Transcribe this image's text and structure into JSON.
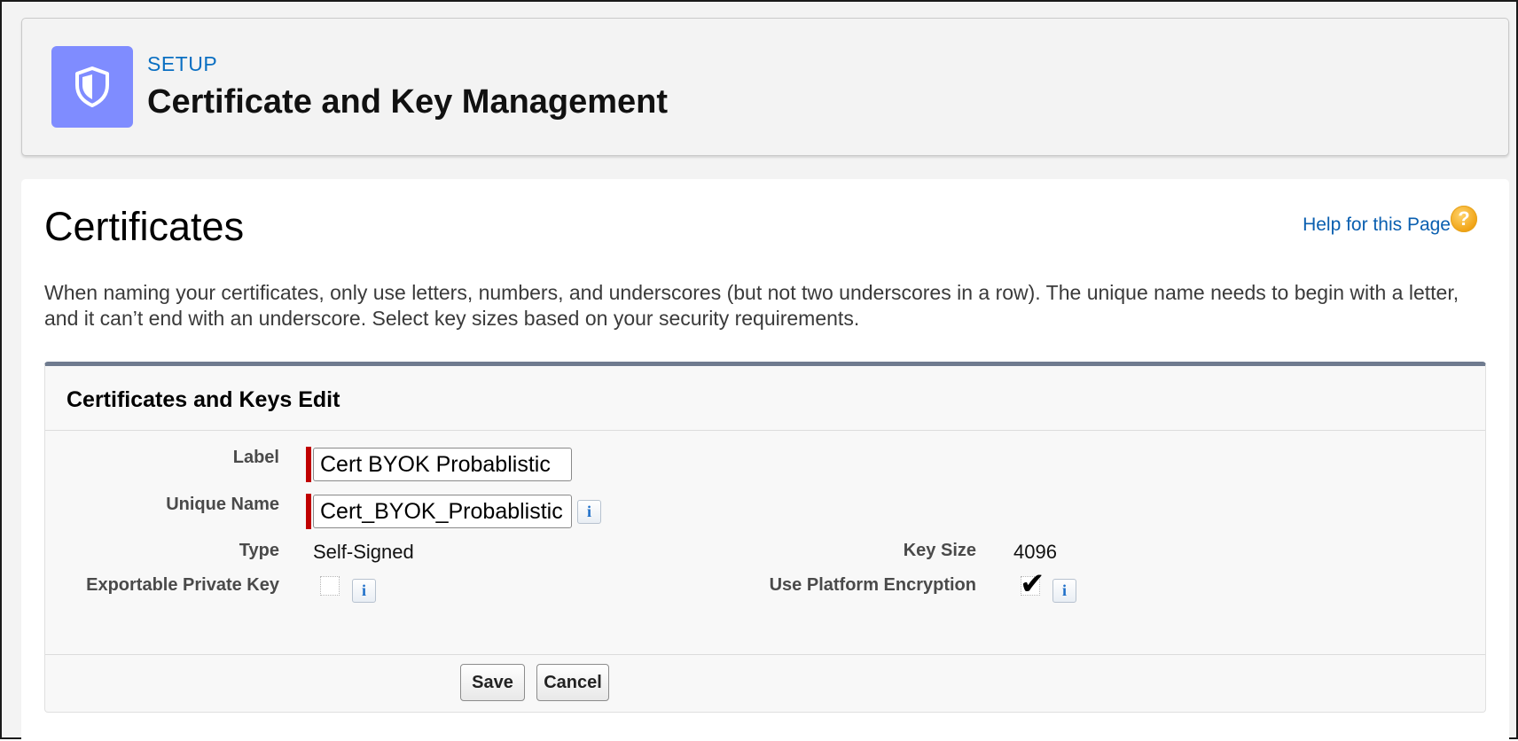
{
  "header": {
    "icon": "shield-icon",
    "section_label": "SETUP",
    "title": "Certificate and Key Management"
  },
  "page": {
    "heading": "Certificates",
    "help_link": "Help for this Page",
    "help_icon": "?",
    "description": "When naming your certificates, only use letters, numbers, and underscores (but not two underscores in a row). The unique name needs to begin with a letter, and it can’t end with an underscore. Select key sizes based on your security requirements."
  },
  "panel": {
    "title": "Certificates and Keys Edit",
    "fields": {
      "label": {
        "label": "Label",
        "value": "Cert BYOK Probablistic"
      },
      "unique_name": {
        "label": "Unique Name",
        "value": "Cert_BYOK_Probablistic"
      },
      "type": {
        "label": "Type",
        "value": "Self-Signed"
      },
      "key_size": {
        "label": "Key Size",
        "value": "4096"
      },
      "exportable_private_key": {
        "label": "Exportable Private Key",
        "checked": false
      },
      "use_platform_encryption": {
        "label": "Use Platform Encryption",
        "checked": true,
        "mark": "✔"
      }
    },
    "info_glyph": "i",
    "buttons": {
      "save": "Save",
      "cancel": "Cancel"
    }
  },
  "colors": {
    "accent": "#0a6fc2",
    "icon_bg": "#7f8cff",
    "required": "#c00000",
    "panel_top_border": "#6f7b8f",
    "help_icon": "#f0a213"
  }
}
